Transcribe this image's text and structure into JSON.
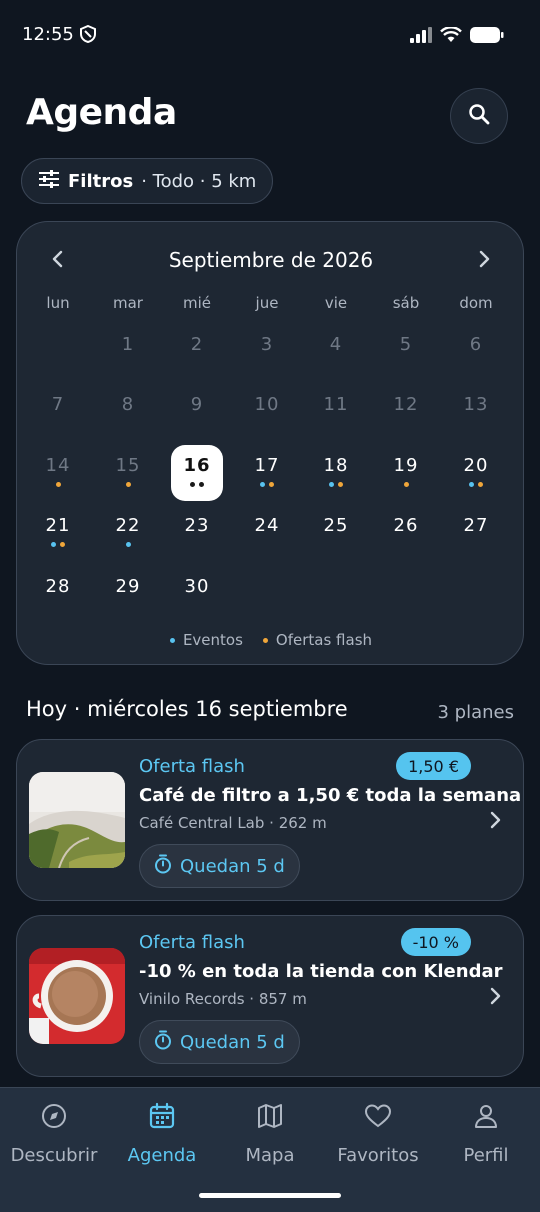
{
  "status_bar": {
    "time": "12:55"
  },
  "header": {
    "title": "Agenda"
  },
  "filters": {
    "label": "Filtros",
    "extra": " · Todo · 5 km"
  },
  "calendar": {
    "month": "Septiembre de 2026",
    "weekdays": [
      "lun",
      "mar",
      "mié",
      "jue",
      "vie",
      "sáb",
      "dom"
    ],
    "weeks": [
      [
        null,
        {
          "d": "1",
          "muted": true
        },
        {
          "d": "2",
          "muted": true
        },
        {
          "d": "3",
          "muted": true
        },
        {
          "d": "4",
          "muted": true
        },
        {
          "d": "5",
          "muted": true
        },
        {
          "d": "6",
          "muted": true
        }
      ],
      [
        {
          "d": "7",
          "muted": true
        },
        {
          "d": "8",
          "muted": true
        },
        {
          "d": "9",
          "muted": true
        },
        {
          "d": "10",
          "muted": true
        },
        {
          "d": "11",
          "muted": true
        },
        {
          "d": "12",
          "muted": true
        },
        {
          "d": "13",
          "muted": true
        }
      ],
      [
        {
          "d": "14",
          "muted": true,
          "dots": [
            "orange"
          ]
        },
        {
          "d": "15",
          "muted": true,
          "dots": [
            "orange"
          ]
        },
        {
          "d": "16",
          "today": true,
          "dots": [
            "dark",
            "dark"
          ]
        },
        {
          "d": "17",
          "dots": [
            "blue",
            "orange"
          ]
        },
        {
          "d": "18",
          "dots": [
            "blue",
            "orange"
          ]
        },
        {
          "d": "19",
          "dots": [
            "orange"
          ]
        },
        {
          "d": "20",
          "dots": [
            "blue",
            "orange"
          ]
        }
      ],
      [
        {
          "d": "21",
          "dots": [
            "blue",
            "orange"
          ]
        },
        {
          "d": "22",
          "dots": [
            "blue"
          ]
        },
        {
          "d": "23"
        },
        {
          "d": "24"
        },
        {
          "d": "25"
        },
        {
          "d": "26"
        },
        {
          "d": "27"
        }
      ],
      [
        {
          "d": "28"
        },
        {
          "d": "29"
        },
        {
          "d": "30"
        },
        null,
        null,
        null,
        null
      ]
    ],
    "legend": {
      "events": "Eventos",
      "flash": "Ofertas flash"
    },
    "colors": {
      "events": "#58c2ef",
      "flash": "#f0a63a"
    }
  },
  "today_section": {
    "title": "Hoy · miércoles 16 septiembre",
    "count": "3 planes"
  },
  "plans": [
    {
      "tag": "Oferta flash",
      "price": "1,50 €",
      "title": "Café de filtro a 1,50 € toda la semana",
      "meta": "Café Central Lab · 262 m",
      "timer": "Quedan 5 d",
      "thumb": "landscape"
    },
    {
      "tag": "Oferta flash",
      "price": "-10 %",
      "title": "-10 % en toda la tienda con Klendar",
      "meta": "Vinilo Records · 857 m",
      "timer": "Quedan 5 d",
      "thumb": "coffee-cup"
    }
  ],
  "nav": [
    {
      "label": "Descubrir",
      "icon": "compass-icon"
    },
    {
      "label": "Agenda",
      "icon": "calendar-icon",
      "active": true
    },
    {
      "label": "Mapa",
      "icon": "map-icon"
    },
    {
      "label": "Favoritos",
      "icon": "heart-icon"
    },
    {
      "label": "Perfil",
      "icon": "user-icon"
    }
  ]
}
